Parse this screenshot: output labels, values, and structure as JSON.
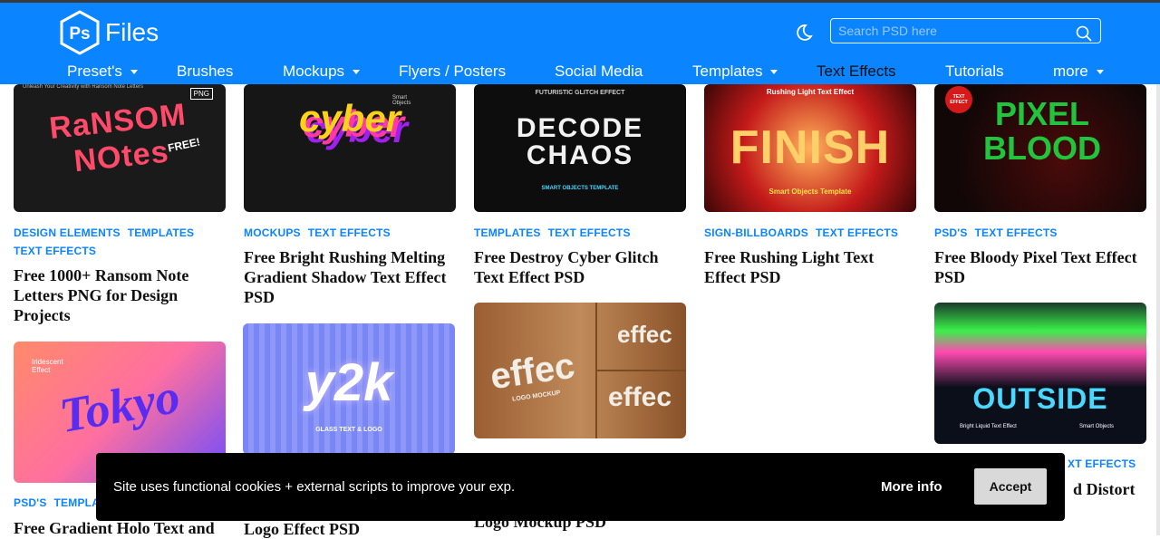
{
  "header": {
    "logo_badge": "Ps",
    "logo_text": "Files",
    "theme_icon": "moon-icon",
    "search_placeholder": "Search PSD here",
    "search_icon": "search-icon"
  },
  "nav": [
    {
      "label": "Preset's",
      "dropdown": true
    },
    {
      "label": "Brushes",
      "dropdown": false
    },
    {
      "label": "Mockups",
      "dropdown": true
    },
    {
      "label": "Flyers / Posters",
      "dropdown": false
    },
    {
      "label": "Social Media",
      "dropdown": false
    },
    {
      "label": "Templates",
      "dropdown": true
    },
    {
      "label": "Text Effects",
      "dropdown": false,
      "active": true
    },
    {
      "label": "Tutorials",
      "dropdown": false
    },
    {
      "label": "more",
      "dropdown": true
    }
  ],
  "posts": [
    {
      "tags": [
        "DESIGN ELEMENTS",
        "TEMPLATES",
        "TEXT EFFECTS"
      ],
      "title": "Free 1000+ Ransom Note Letters PNG for Design Projects",
      "thumb_text": "RaNSOM NOtes",
      "bg": "#1a1a1a",
      "fg": "#ff4a6a"
    },
    {
      "tags": [
        "MOCKUPS",
        "TEXT EFFECTS"
      ],
      "title": "Free Bright Rushing Melting Gradient Shadow Text Effect PSD",
      "thumb_text": "cyber",
      "bg": "#161616",
      "fg": "#ffd21a"
    },
    {
      "tags": [
        "TEMPLATES",
        "TEXT EFFECTS"
      ],
      "title": "Free Destroy Cyber Glitch Text Effect PSD",
      "thumb_text": "DECODE CHAOS",
      "bg": "#0d0d0d",
      "fg": "#f2f2f2"
    },
    {
      "tags": [
        "SIGN-BILLBOARDS",
        "TEXT EFFECTS"
      ],
      "title": "Free Rushing Light Text Effect PSD",
      "thumb_text": "FINISH",
      "bg": "#5a0b0b",
      "fg": "#ff9a3a"
    },
    {
      "tags": [
        "PSD'S",
        "TEXT EFFECTS"
      ],
      "title": "Free Bloody Pixel Text Effect PSD",
      "thumb_text": "PIXEL BLOOD",
      "bg": "#120707",
      "fg": "#21c43a"
    },
    {
      "tags": [
        "PSD'S",
        "TEMPLA"
      ],
      "title": "Free Gradient Holo Text and",
      "thumb_text": "Tokyo",
      "bg": "#ff7a7a",
      "fg": "#6a2cff"
    },
    {
      "tags": [],
      "title": "Logo Effect PSD",
      "thumb_text": "y2k",
      "bg": "#6a7cf2",
      "fg": "#ffffff"
    },
    {
      "tags": [],
      "title": "Logo Mockup PSD",
      "thumb_text": "effec",
      "bg": "#a86a3a",
      "fg": "#f2eee6"
    },
    {
      "tags": [
        "XT EFFECTS"
      ],
      "title": "d Distort",
      "thumb_text": "OUTSIDE",
      "bg": "#0a0f1a",
      "fg": "#4ad8ff"
    }
  ],
  "thumb_extras": {
    "ransom_sub": "Unleash Your Creativity with Ransom Note Letters",
    "ransom_png": "PNG",
    "ransom_free": "FREE!",
    "cyber_sub": "Smart Objects",
    "decode_sub": "FUTURISTIC GLITCH EFFECT",
    "decode_foot": "SMART OBJECTS TEMPLATE",
    "finish_sub": "Rushing Light Text Effect",
    "finish_foot": "Smart Objects Template",
    "pixel_badge": "TEXT EFFECT",
    "tokyo_sub": "Iridescent Effect",
    "y2k_sub": "GLASS TEXT & LOGO",
    "effec_small": "LOGO MOCKUP",
    "outside_left": "Bright Liquid Text Effect",
    "outside_right": "Smart Objects"
  },
  "cookie": {
    "text": "Site uses functional cookies + external scripts to improve your exp.",
    "more_info": "More info",
    "accept": "Accept"
  }
}
